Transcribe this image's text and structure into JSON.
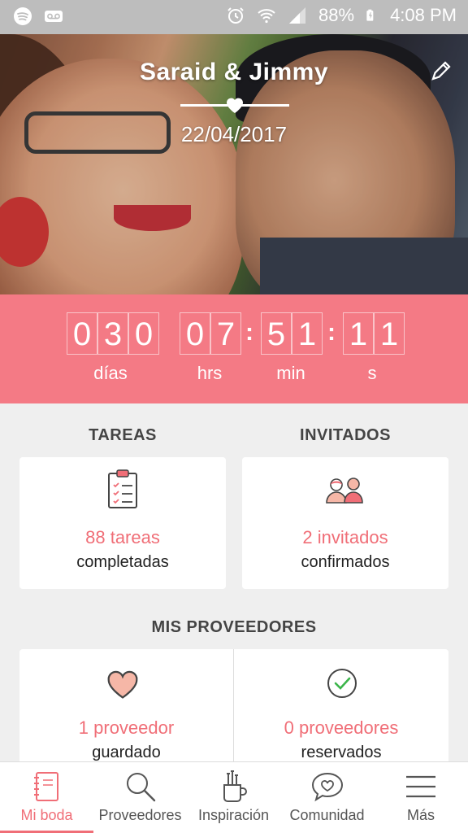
{
  "status_bar": {
    "battery": "88%",
    "time": "4:08 PM"
  },
  "hero": {
    "couple_names": "Saraid & Jimmy",
    "wedding_date": "22/04/2017"
  },
  "countdown": {
    "days_digits": [
      "0",
      "3",
      "0"
    ],
    "hours_digits": [
      "0",
      "7"
    ],
    "minutes_digits": [
      "5",
      "1"
    ],
    "seconds_digits": [
      "1",
      "1"
    ],
    "labels": {
      "days": "días",
      "hours": "hrs",
      "minutes": "min",
      "seconds": "s"
    }
  },
  "tareas": {
    "title": "TAREAS",
    "count": "88 tareas",
    "sub": "completadas"
  },
  "invitados": {
    "title": "INVITADOS",
    "count": "2 invitados",
    "sub": "confirmados"
  },
  "proveedores": {
    "title": "MIS PROVEEDORES",
    "saved_count": "1 proveedor",
    "saved_sub": "guardado",
    "reserved_count": "0 proveedores",
    "reserved_sub": "reservados"
  },
  "bottom_nav": {
    "items": [
      {
        "label": "Mi boda",
        "icon": "notebook-icon",
        "active": true
      },
      {
        "label": "Proveedores",
        "icon": "search-icon",
        "active": false
      },
      {
        "label": "Inspiración",
        "icon": "brushes-icon",
        "active": false
      },
      {
        "label": "Comunidad",
        "icon": "chat-heart-icon",
        "active": false
      },
      {
        "label": "Más",
        "icon": "menu-icon",
        "active": false
      }
    ]
  },
  "colors": {
    "accent": "#f47a85",
    "accent_text": "#f06e77",
    "status_bar": "#bdbdbd",
    "background": "#efefef"
  }
}
